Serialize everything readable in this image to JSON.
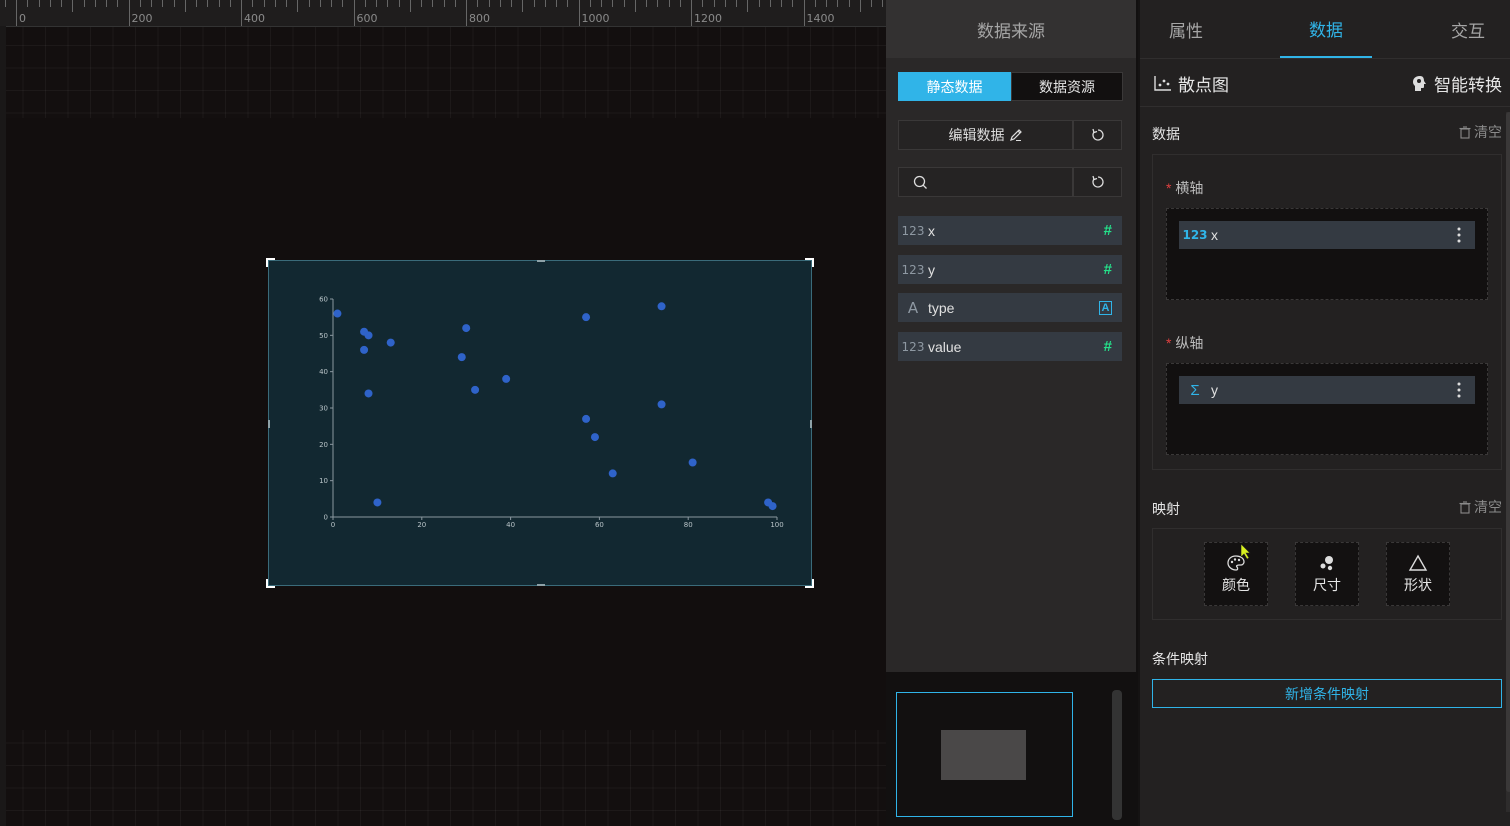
{
  "ruler": {
    "labels": [
      "0",
      "200",
      "400",
      "600",
      "800",
      "1000",
      "1200",
      "1400"
    ]
  },
  "mid": {
    "header": "数据来源",
    "seg_static": "静态数据",
    "seg_resource": "数据资源",
    "edit_data": "编辑数据",
    "search_placeholder": "",
    "fields": [
      {
        "type_icon": "123",
        "name": "x",
        "badge_icon": "hash-icon"
      },
      {
        "type_icon": "123",
        "name": "y",
        "badge_icon": "hash-icon"
      },
      {
        "type_icon": "A",
        "name": "type",
        "badge_icon": "text-badge-icon"
      },
      {
        "type_icon": "123",
        "name": "value",
        "badge_icon": "hash-icon"
      }
    ]
  },
  "right": {
    "tabs": [
      "属性",
      "数据",
      "交互"
    ],
    "active_tab": "数据",
    "chart_type": "散点图",
    "smart": "智能转换",
    "data_title": "数据",
    "clear": "清空",
    "x_axis_label": "横轴",
    "x_field": {
      "type_icon": "123",
      "name": "x"
    },
    "y_axis_label": "纵轴",
    "y_field": {
      "type_icon": "Σ",
      "name": "y"
    },
    "mapping_title": "映射",
    "mapping_clear": "清空",
    "map_color": "颜色",
    "map_size": "尺寸",
    "map_shape": "形状",
    "cond_title": "条件映射",
    "add_cond": "新增条件映射",
    "required_mark": "*"
  },
  "colors": {
    "accent": "#30b4e8",
    "dot": "#2f63c9",
    "hash": "#25e08a",
    "chart_bg": "#122831"
  },
  "chart_data": {
    "type": "scatter",
    "xlim": [
      0,
      100
    ],
    "ylim": [
      0,
      60
    ],
    "xticks": [
      "0",
      "20",
      "40",
      "60",
      "80",
      "100"
    ],
    "yticks": [
      "0",
      "10",
      "20",
      "30",
      "40",
      "50",
      "60"
    ],
    "points": [
      {
        "x": 1,
        "y": 56
      },
      {
        "x": 7,
        "y": 51
      },
      {
        "x": 8,
        "y": 50
      },
      {
        "x": 7,
        "y": 46
      },
      {
        "x": 13,
        "y": 48
      },
      {
        "x": 8,
        "y": 34
      },
      {
        "x": 10,
        "y": 4
      },
      {
        "x": 29,
        "y": 44
      },
      {
        "x": 30,
        "y": 52
      },
      {
        "x": 32,
        "y": 35
      },
      {
        "x": 39,
        "y": 38
      },
      {
        "x": 57,
        "y": 55
      },
      {
        "x": 57,
        "y": 27
      },
      {
        "x": 59,
        "y": 22
      },
      {
        "x": 63,
        "y": 12
      },
      {
        "x": 74,
        "y": 58
      },
      {
        "x": 74,
        "y": 31
      },
      {
        "x": 81,
        "y": 15
      },
      {
        "x": 98,
        "y": 4
      },
      {
        "x": 99,
        "y": 3
      }
    ]
  }
}
